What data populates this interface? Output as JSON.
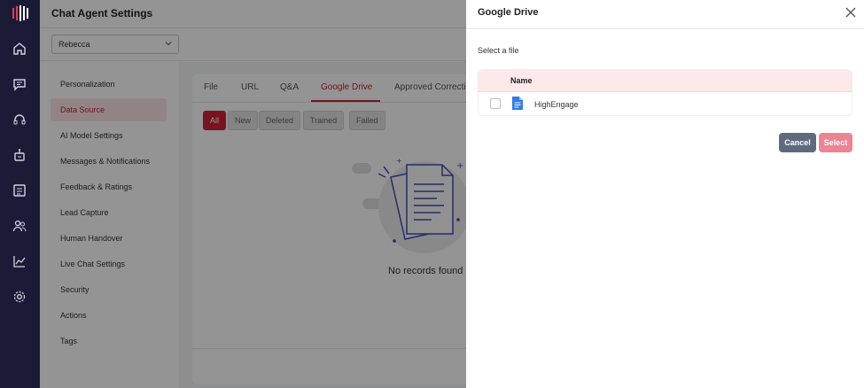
{
  "base": {
    "title": "Chat Agent Settings",
    "agent_select": {
      "value": "Rebecca"
    },
    "menu": [
      {
        "label": "Personalization",
        "active": false
      },
      {
        "label": "Data Source",
        "active": true
      },
      {
        "label": "AI Model Settings",
        "active": false
      },
      {
        "label": "Messages & Notifications",
        "active": false
      },
      {
        "label": "Feedback & Ratings",
        "active": false
      },
      {
        "label": "Lead Capture",
        "active": false
      },
      {
        "label": "Human Handover",
        "active": false
      },
      {
        "label": "Live Chat Settings",
        "active": false
      },
      {
        "label": "Security",
        "active": false
      },
      {
        "label": "Actions",
        "active": false
      },
      {
        "label": "Tags",
        "active": false
      }
    ],
    "tabs": [
      "File",
      "URL",
      "Q&A",
      "Google Drive",
      "Approved Correctio"
    ],
    "active_tab": "Google Drive",
    "filters": [
      "All",
      "New",
      "Deleted",
      "Trained",
      "Failed"
    ],
    "active_filter": "All",
    "empty_text": "No records found"
  },
  "rail_icons": [
    "logo-icon",
    "home-icon",
    "chat-icon",
    "headset-icon",
    "bot-icon",
    "report-icon",
    "users-icon",
    "analytics-icon",
    "settings-icon"
  ],
  "drawer": {
    "title": "Google Drive",
    "subtitle": "Select a file",
    "table": {
      "column": "Name",
      "rows": [
        {
          "name": "HighEngage",
          "icon": "google-doc-icon",
          "checked": false
        }
      ]
    },
    "cancel_label": "Cancel",
    "select_label": "Select"
  },
  "colors": {
    "rail": "#1c1b37",
    "accent": "#c2203a",
    "header_row": "#fde8ea",
    "cancel": "#5e6a7e",
    "select": "#ec8494"
  }
}
